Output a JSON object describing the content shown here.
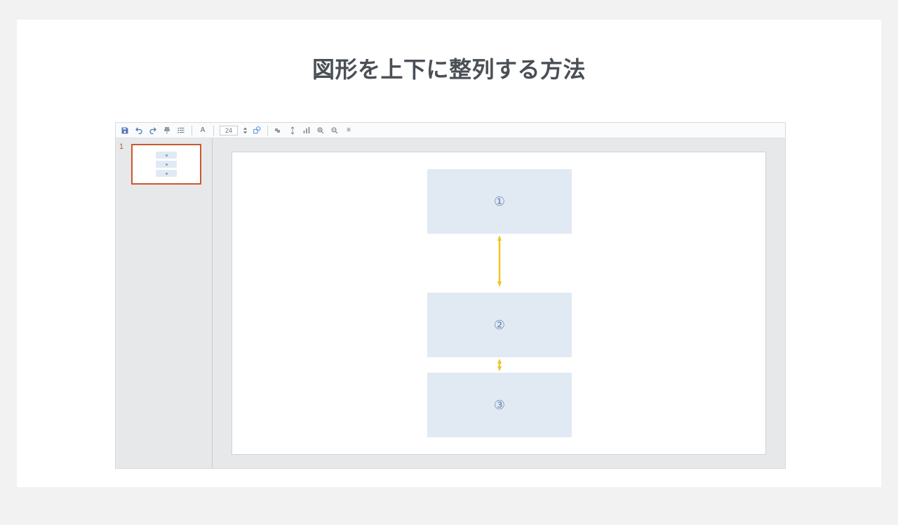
{
  "title": "図形を上下に整列する方法",
  "toolbar": {
    "fontSize": "24"
  },
  "thumbnails": [
    {
      "number": "1"
    }
  ],
  "shapes": [
    {
      "label": "①"
    },
    {
      "label": "②"
    },
    {
      "label": "③"
    }
  ]
}
